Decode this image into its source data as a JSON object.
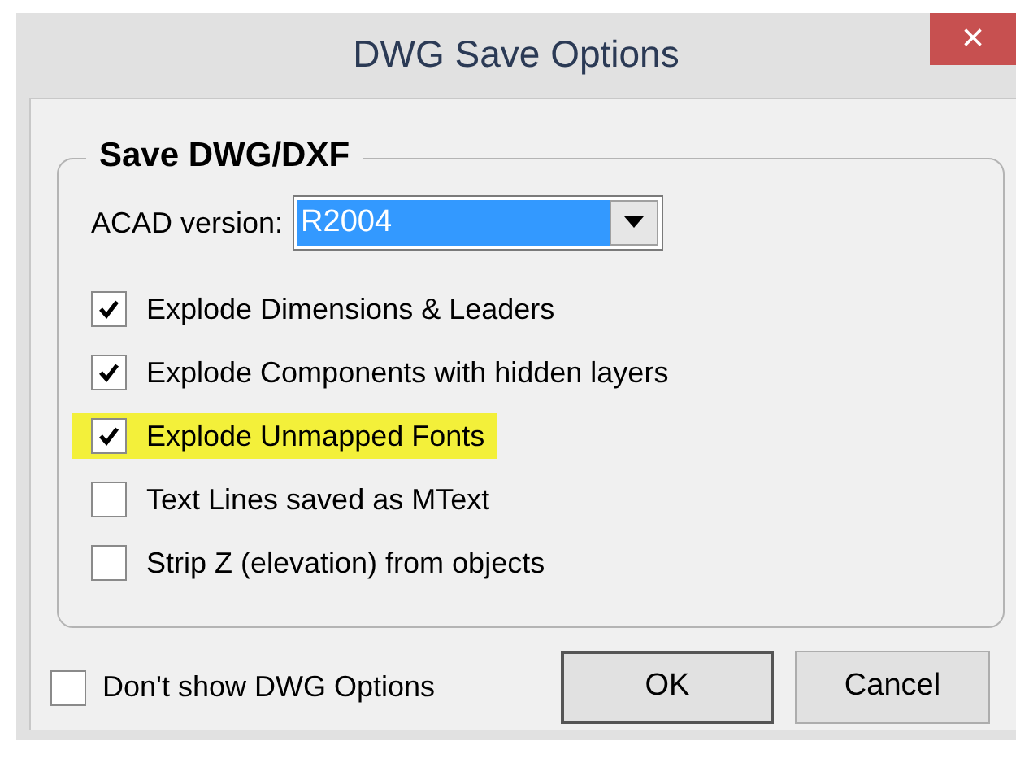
{
  "window": {
    "title": "DWG Save Options",
    "close": "×"
  },
  "group": {
    "title": "Save DWG/DXF"
  },
  "acad_version": {
    "label": "ACAD version:",
    "value": "R2004"
  },
  "options": [
    {
      "label": "Explode Dimensions & Leaders",
      "checked": true,
      "highlighted": false
    },
    {
      "label": "Explode Components with hidden layers",
      "checked": true,
      "highlighted": false
    },
    {
      "label": "Explode Unmapped Fonts",
      "checked": true,
      "highlighted": true
    },
    {
      "label": "Text Lines saved as MText",
      "checked": false,
      "highlighted": false
    },
    {
      "label": "Strip Z (elevation) from objects",
      "checked": false,
      "highlighted": false
    }
  ],
  "dont_show": {
    "label": "Don't show DWG Options",
    "checked": false
  },
  "buttons": [
    {
      "label": "OK",
      "default": true
    },
    {
      "label": "Cancel",
      "default": false
    }
  ]
}
